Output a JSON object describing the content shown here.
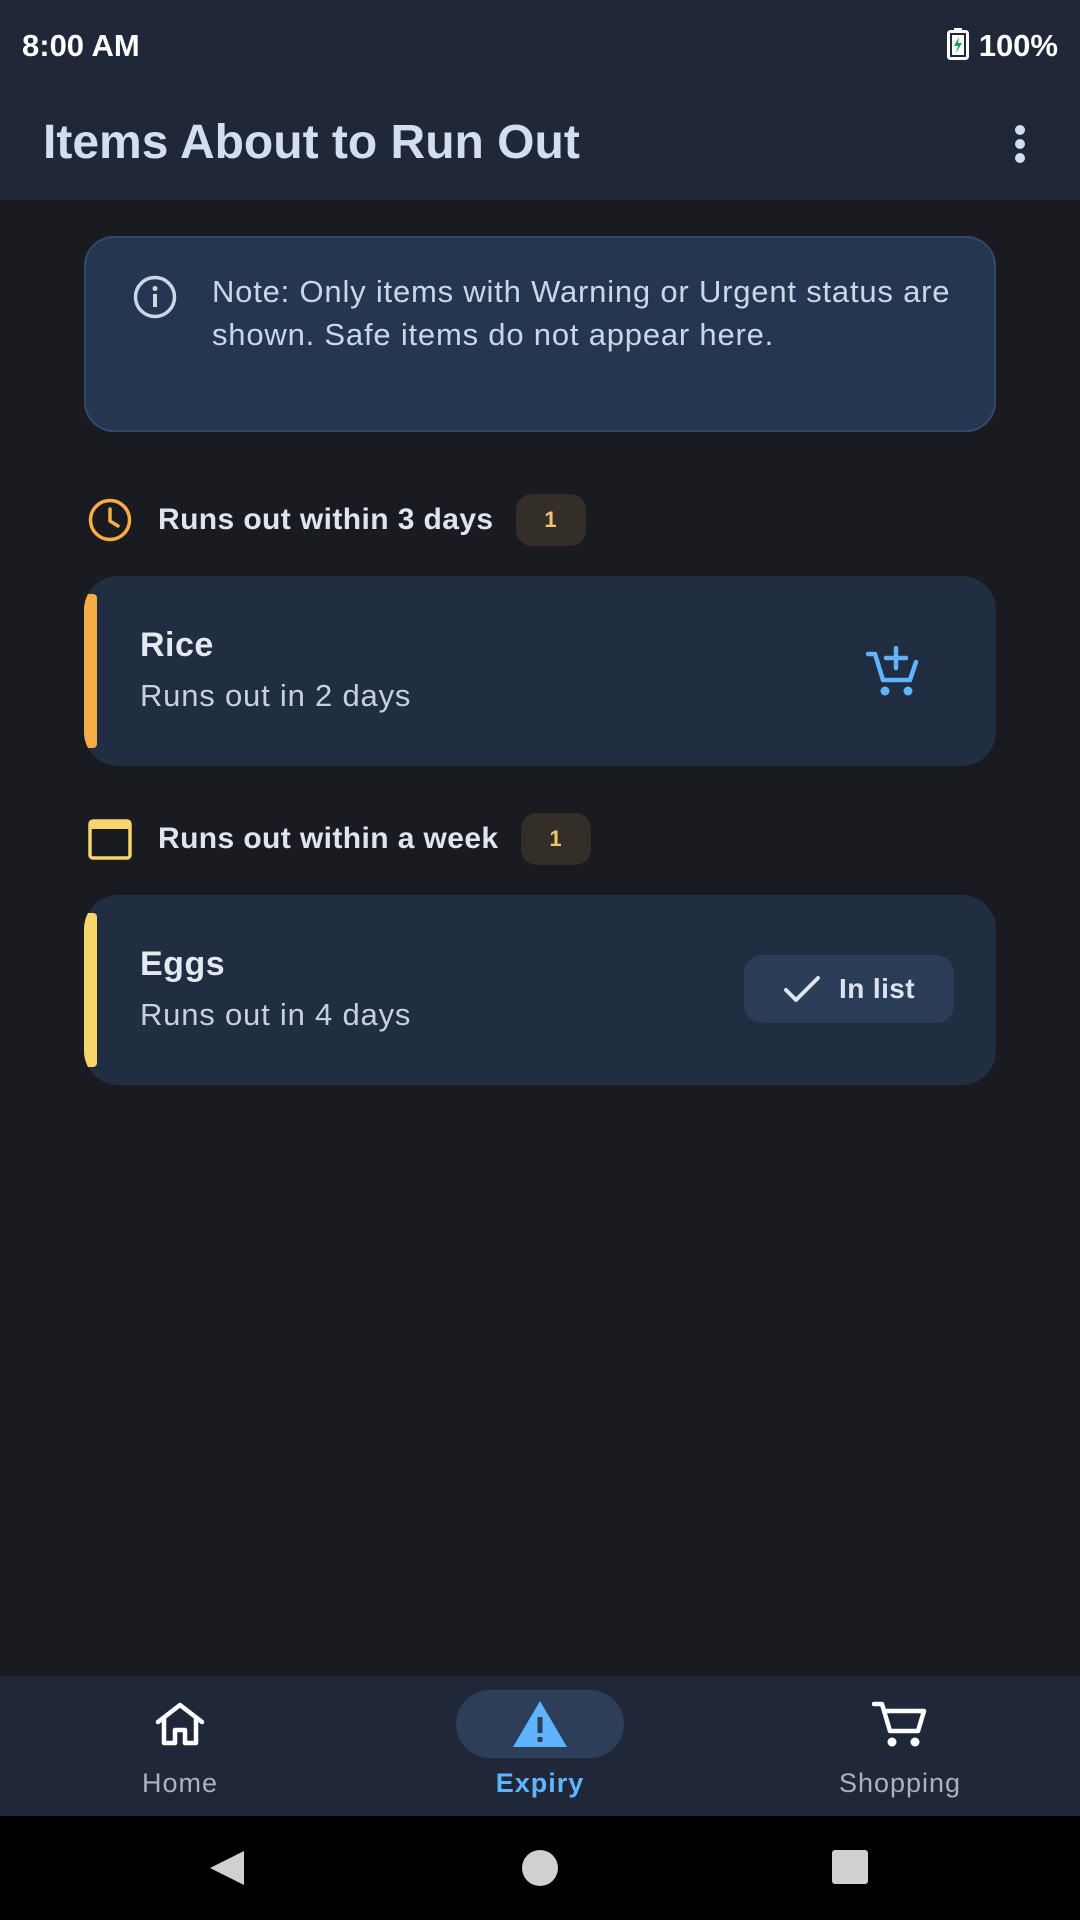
{
  "status_bar": {
    "time": "8:00 AM",
    "battery": "100%"
  },
  "app_bar": {
    "title": "Items About to Run Out"
  },
  "note": {
    "text": "Note: Only items with Warning or Urgent status are shown. Safe items do not appear here."
  },
  "sections": [
    {
      "title": "Runs out within 3 days",
      "count": "1",
      "icon": "clock-icon",
      "items": [
        {
          "name": "Rice",
          "subtitle": "Runs out in 2 days",
          "accent": "#f6ad47",
          "action": "add-to-cart"
        }
      ]
    },
    {
      "title": "Runs out within a week",
      "count": "1",
      "icon": "calendar-icon",
      "items": [
        {
          "name": "Eggs",
          "subtitle": "Runs out in 4 days",
          "accent": "#f6d56a",
          "action": "in-list",
          "action_label": "In list"
        }
      ]
    }
  ],
  "bottom_nav": [
    {
      "label": "Home",
      "icon": "home-icon",
      "active": false
    },
    {
      "label": "Expiry",
      "icon": "warning-icon",
      "active": true
    },
    {
      "label": "Shopping",
      "icon": "cart-icon",
      "active": false
    }
  ],
  "colors": {
    "background": "#191b21",
    "header": "#1f2739",
    "card": "#212d40",
    "note_card": "#253650",
    "accent_blue": "#5fb4ff",
    "urgent_orange": "#f6ad47",
    "warning_yellow": "#f6d56a"
  }
}
